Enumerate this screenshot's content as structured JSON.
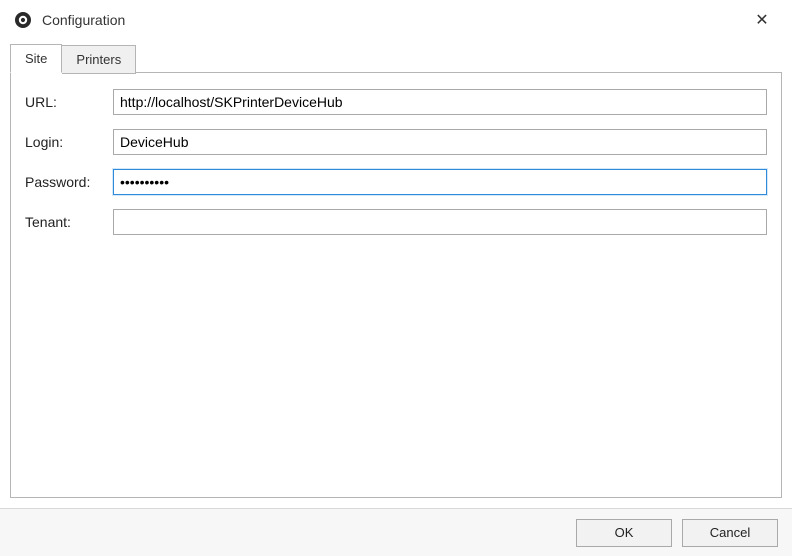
{
  "window": {
    "title": "Configuration",
    "close_symbol": "✕"
  },
  "tabs": [
    {
      "label": "Site",
      "active": true
    },
    {
      "label": "Printers",
      "active": false
    }
  ],
  "form": {
    "url": {
      "label": "URL:",
      "value": "http://localhost/SKPrinterDeviceHub"
    },
    "login": {
      "label": "Login:",
      "value": "DeviceHub"
    },
    "password": {
      "label": "Password:",
      "value": "••••••••••"
    },
    "tenant": {
      "label": "Tenant:",
      "value": ""
    }
  },
  "buttons": {
    "ok": "OK",
    "cancel": "Cancel"
  }
}
